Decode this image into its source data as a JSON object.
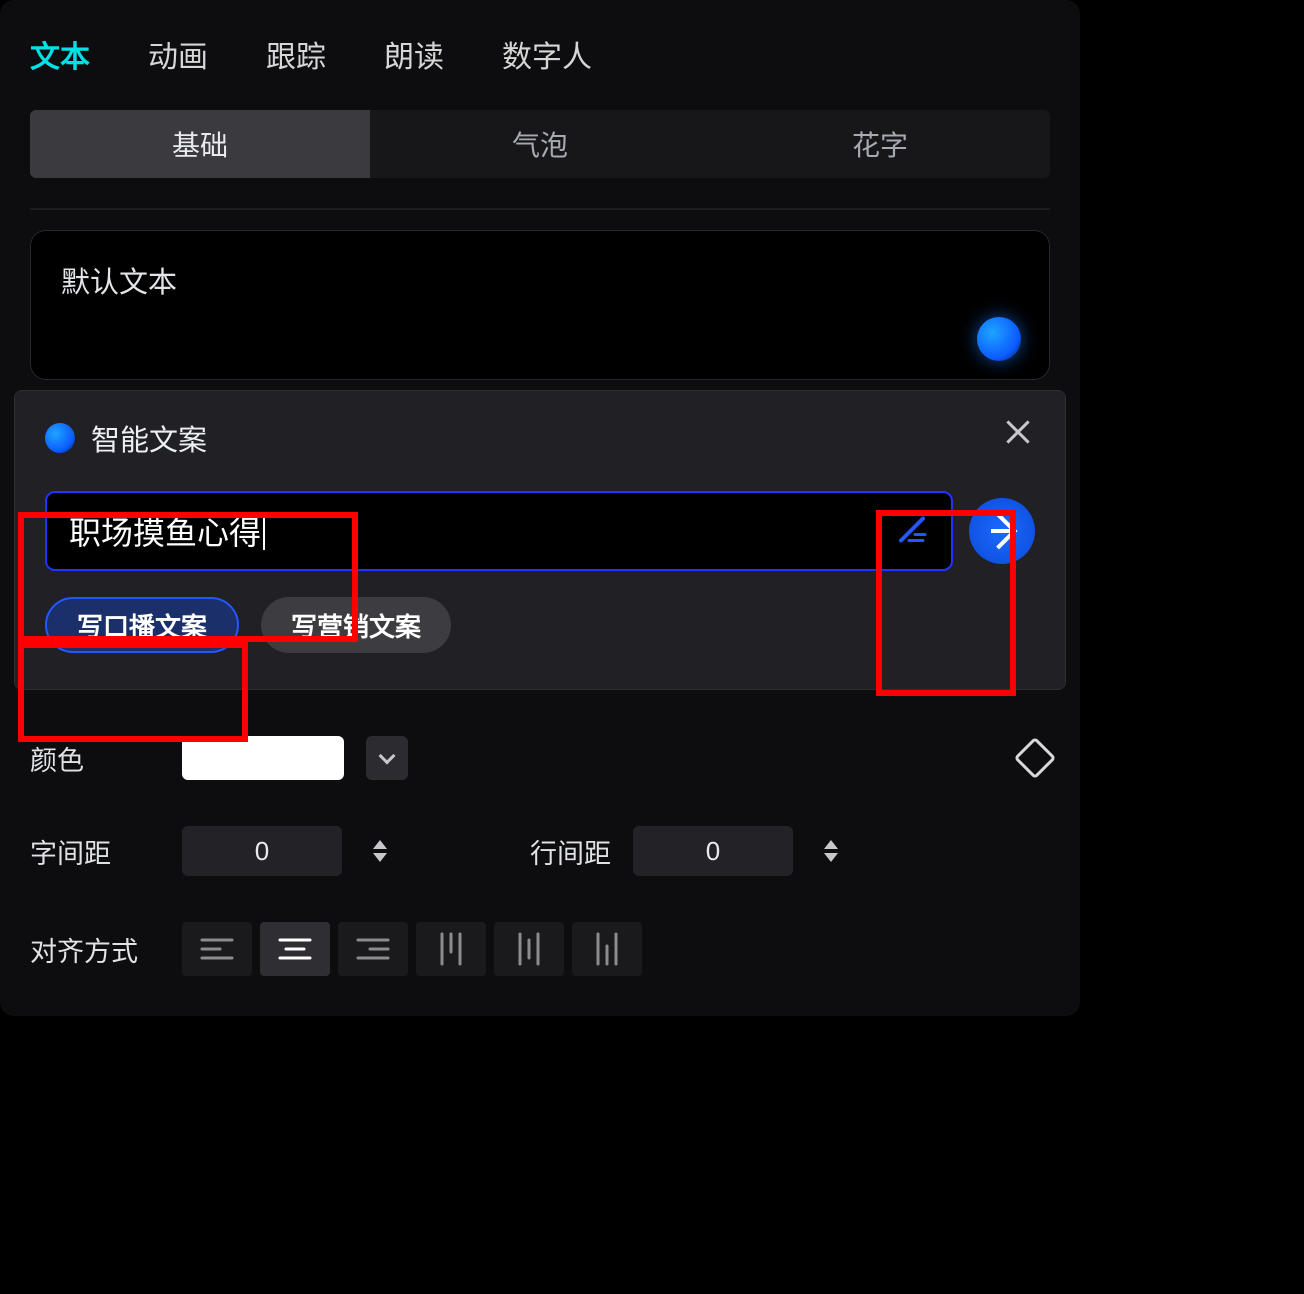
{
  "tabs": {
    "text": "文本",
    "anim": "动画",
    "track": "跟踪",
    "read": "朗读",
    "avatar": "数字人"
  },
  "subtabs": {
    "basic": "基础",
    "bubble": "气泡",
    "fancy": "花字"
  },
  "textbox": {
    "default": "默认文本"
  },
  "popup": {
    "title": "智能文案",
    "input": "职场摸鱼心得",
    "chip_script": "写口播文案",
    "chip_marketing": "写营销文案"
  },
  "labels": {
    "color": "颜色",
    "letter_spacing": "字间距",
    "line_spacing": "行间距",
    "align": "对齐方式"
  },
  "values": {
    "letter_spacing": "0",
    "line_spacing": "0"
  }
}
